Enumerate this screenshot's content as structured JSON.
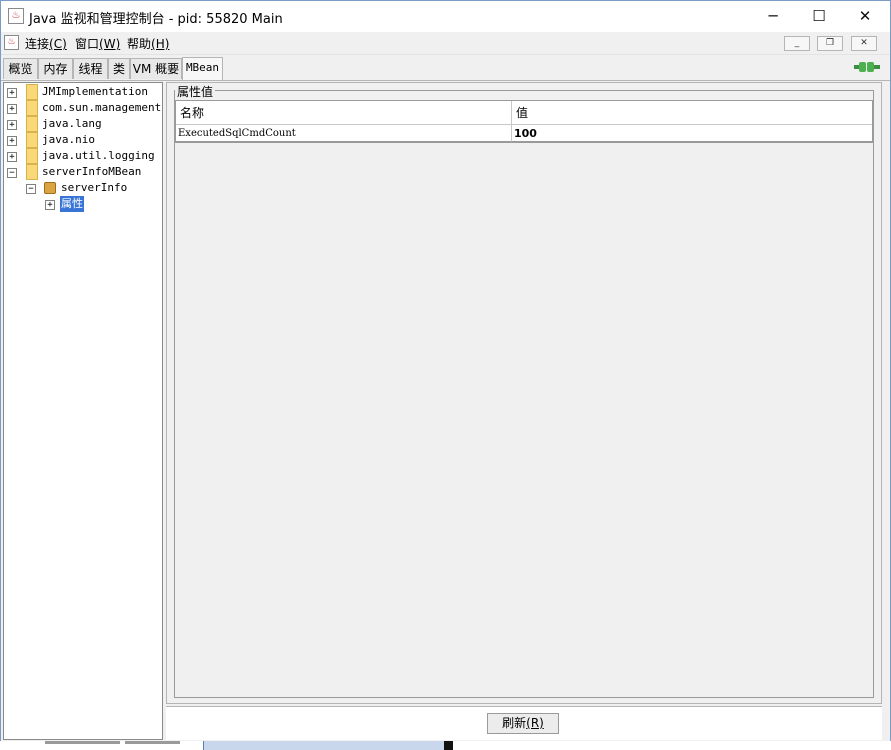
{
  "window": {
    "title": "Java 监视和管理控制台 - pid: 55820 Main",
    "minimize_glyph": "─",
    "maximize_glyph": "☐",
    "close_glyph": "✕"
  },
  "menubar": {
    "items": [
      {
        "label": "连接",
        "mnemonic": "(C)"
      },
      {
        "label": "窗口",
        "mnemonic": "(W)"
      },
      {
        "label": "帮助",
        "mnemonic": "(H)"
      }
    ],
    "inner_buttons": [
      "_",
      "❐",
      "✕"
    ]
  },
  "tabs": [
    {
      "label": "概览",
      "active": false
    },
    {
      "label": "内存",
      "active": false
    },
    {
      "label": "线程",
      "active": false
    },
    {
      "label": "类",
      "active": false
    },
    {
      "label": "VM 概要",
      "active": false
    },
    {
      "label": "MBean",
      "active": true
    }
  ],
  "tree": {
    "nodes": [
      {
        "label": "JMImplementation",
        "expander": "+"
      },
      {
        "label": "com.sun.management",
        "expander": "+"
      },
      {
        "label": "java.lang",
        "expander": "+"
      },
      {
        "label": "java.nio",
        "expander": "+"
      },
      {
        "label": "java.util.logging",
        "expander": "+"
      },
      {
        "label": "serverInfoMBean",
        "expander": "−"
      }
    ],
    "child": {
      "label": "serverInfo",
      "expander": "−"
    },
    "grandchild": {
      "label": "属性",
      "expander": "+",
      "selected": true
    }
  },
  "attributes": {
    "group_title": "属性值",
    "columns": [
      "名称",
      "值"
    ],
    "rows": [
      {
        "name": "ExecutedSqlCmdCount",
        "value": "100"
      }
    ]
  },
  "refresh_button": {
    "label": "刷新",
    "mnemonic": "(R)"
  },
  "colors": {
    "selection": "#3875d7",
    "folder": "#f9d977",
    "connect_icon": "#4caf50"
  },
  "icons": {
    "app": "java-cup-icon",
    "connection": "connected-plug-icon",
    "folder": "folder-icon",
    "bean": "mbean-icon"
  }
}
